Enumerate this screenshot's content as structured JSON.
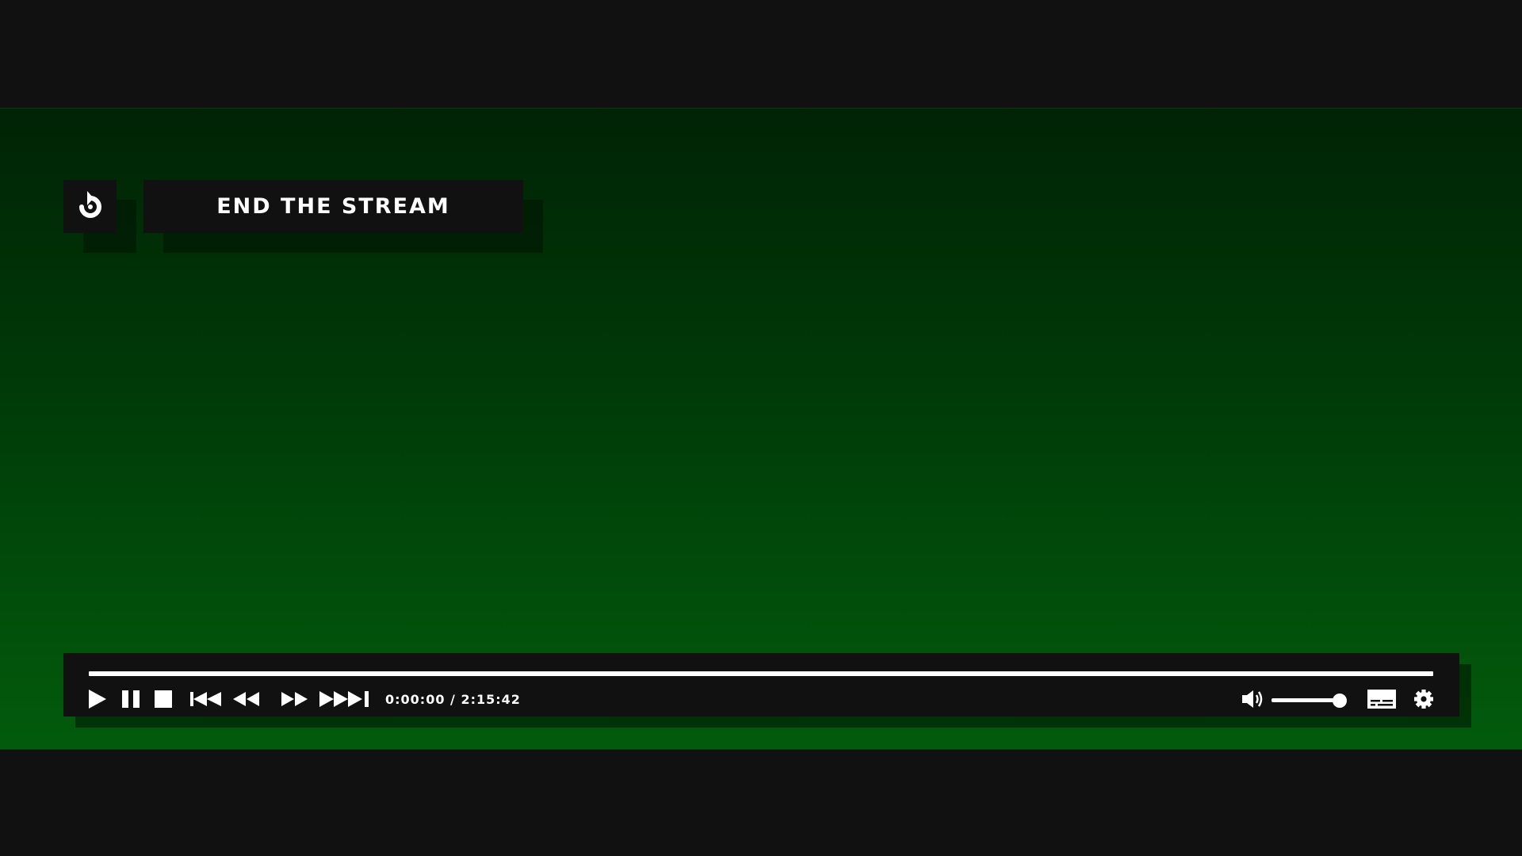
{
  "header": {
    "back_icon": "restart-arrow-icon",
    "title": "END THE STREAM"
  },
  "player": {
    "current_time": "0:00:00",
    "separator": "/",
    "duration": "2:15:42",
    "progress": 1.0,
    "volume": 1.0,
    "controls": [
      "play-icon",
      "pause-icon",
      "stop-icon",
      "skip-back-icon",
      "rewind-icon",
      "fast-forward-icon",
      "skip-forward-icon",
      "volume-icon",
      "subtitles-icon",
      "gear-icon"
    ]
  },
  "colors": {
    "background": "#111111",
    "video_top": "#002305",
    "video_bottom": "#025b0c",
    "panel": "#111111",
    "foreground": "#ffffff"
  }
}
